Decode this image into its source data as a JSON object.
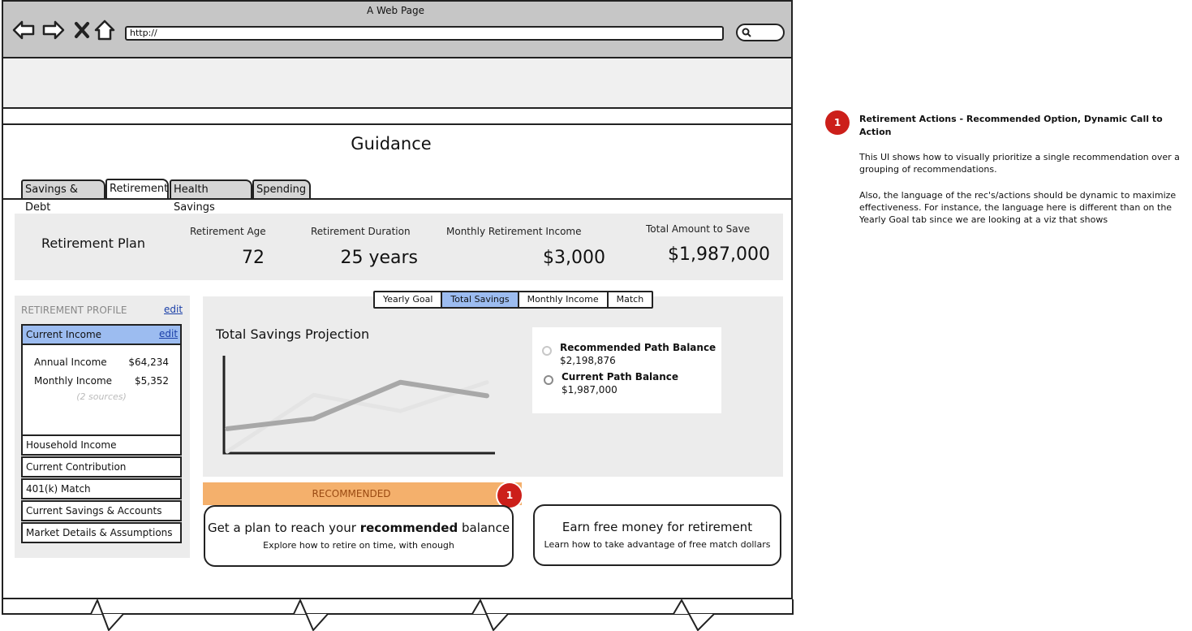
{
  "browser": {
    "title": "A Web Page",
    "url": "http://"
  },
  "page": {
    "title": "Guidance",
    "tabs": [
      {
        "label": "Savings & Debt",
        "active": false
      },
      {
        "label": "Retirement",
        "active": true
      },
      {
        "label": "Health Savings",
        "active": false
      },
      {
        "label": "Spending",
        "active": false
      }
    ]
  },
  "summary": {
    "plan_label": "Retirement Plan",
    "age_label": "Retirement Age",
    "age_value": "72",
    "duration_label": "Retirement Duration",
    "duration_value": "25 years",
    "income_label": "Monthly Retirement Income",
    "income_value": "$3,000",
    "total_label": "Total Amount to Save",
    "total_value": "$1,987,000"
  },
  "profile": {
    "heading": "RETIREMENT PROFILE",
    "edit": "edit",
    "current_income": "Current Income",
    "current_income_edit": "edit",
    "annual_label": "Annual Income",
    "annual_value": "$64,234",
    "monthly_label": "Monthly Income",
    "monthly_value": "$5,352",
    "sources": "(2 sources)",
    "items": [
      "Household Income",
      "Current Contribution",
      "401(k) Match",
      "Current Savings & Accounts",
      "Market Details & Assumptions"
    ]
  },
  "view_tabs": [
    {
      "label": "Yearly Goal",
      "active": false
    },
    {
      "label": "Total Savings",
      "active": true
    },
    {
      "label": "Monthly Income",
      "active": false
    },
    {
      "label": "Match",
      "active": false
    }
  ],
  "chart": {
    "title": "Total Savings Projection",
    "legend": [
      {
        "title": "Recommended Path Balance",
        "value": "$2,198,876"
      },
      {
        "title": "Current Path Balance",
        "value": "$1,987,000"
      }
    ]
  },
  "chart_data": {
    "type": "line",
    "title": "Total Savings Projection",
    "x": [
      0,
      1,
      2,
      3
    ],
    "series": [
      {
        "name": "Recommended Path Balance",
        "values": [
          0.0,
          0.67,
          0.48,
          0.82
        ],
        "color": "#e4e4e4"
      },
      {
        "name": "Current Path Balance",
        "values": [
          0.27,
          0.39,
          0.82,
          0.66
        ],
        "color": "#a8a8a8"
      }
    ],
    "ylim": [
      0,
      1
    ],
    "grid": false
  },
  "recommendations": {
    "band_label": "RECOMMENDED",
    "badge": "1",
    "cards": [
      {
        "title_pre": "Get a plan to reach your ",
        "title_bold": "recommended",
        "title_post": " balance",
        "subtitle": "Explore how to retire on time, with enough"
      },
      {
        "title": "Earn free money for retirement",
        "subtitle": "Learn how to take advantage of free match dollars"
      }
    ]
  },
  "annotation": {
    "badge": "1",
    "title": "Retirement Actions - Recommended Option, Dynamic Call to Action",
    "p1": "This UI shows how to visually prioritize a single recommendation over a grouping of recommendations.",
    "p2": "Also, the language of the rec's/actions should be dynamic to maximize effectiveness. For instance, the language here is different than on the Yearly Goal tab since we are looking at a viz that shows"
  },
  "colors": {
    "accent_blue": "#9cbcf0",
    "recommended_orange": "#f4b06c",
    "badge_red": "#cc1f1a",
    "panel_gray": "#ececec"
  }
}
